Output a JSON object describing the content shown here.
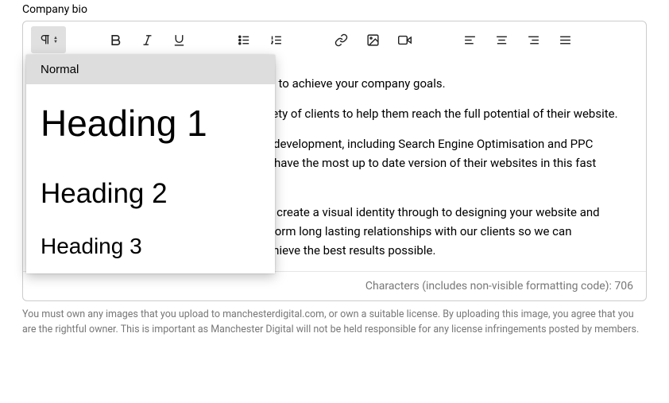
{
  "field_label": "Company bio",
  "dropdown": {
    "normal": "Normal",
    "h1": "Heading 1",
    "h2": "Heading 2",
    "h3": "Heading 3"
  },
  "body": {
    "p1": "Creative, innovative, enthusiastic and driven to achieve your company goals.",
    "p2": "Phoenix Digital Media Ltd works with a variety of clients to help them reach the full potential of their website.",
    "p3": "We provide support for all of our sites post development, including Search Engine Optimisation and PPC Management. This ensures that our clients have the most up to date version of their websites in this fast paced industry.",
    "p4": "At Phoenix we can help you from helping to create a visual identity through to designing your website and marketing your website online. We wish to form long lasting relationships with our clients so we can continuously develop their websites and achieve the best results possible."
  },
  "footer": {
    "char_label": "Characters (includes non-visible formatting code): ",
    "char_count": "706"
  },
  "disclaimer": "You must own any images that you upload to manchesterdigital.com, or own a suitable license. By uploading this image, you agree that you are the rightful owner. This is important as Manchester Digital will not be held responsible for any license infringements posted by members."
}
